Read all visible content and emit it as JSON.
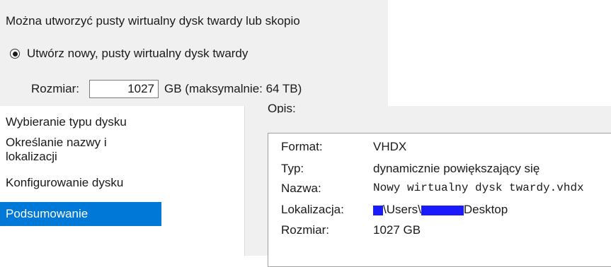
{
  "wizard": {
    "intro_text": "Można utworzyć pusty wirtualny dysk twardy lub skopio",
    "new_disk_option": "Utwórz nowy, pusty wirtualny dysk twardy",
    "size_label": "Rozmiar:",
    "size_value": "1027",
    "size_unit": "GB (maksymalnie: 64 TB)"
  },
  "sidebar": {
    "items": [
      {
        "label": "Wybieranie typu dysku"
      },
      {
        "label": "Określanie nazwy i lokalizacji"
      },
      {
        "label": "Konfigurowanie dysku"
      },
      {
        "label": "Podsumowanie"
      }
    ],
    "active_index": 3
  },
  "summary": {
    "heading": "Opis:",
    "rows": [
      {
        "key": "Format:",
        "value": "VHDX"
      },
      {
        "key": "Typ:",
        "value": "dynamicznie powiększający się"
      },
      {
        "key": "Nazwa:",
        "value": "Nowy wirtualny dysk twardy.vhdx"
      },
      {
        "key": "Lokalizacja:",
        "value_parts": [
          "\\Users\\",
          "Desktop"
        ]
      },
      {
        "key": "Rozmiar:",
        "value": "1027 GB"
      }
    ]
  },
  "colors": {
    "accent": "#0078d7",
    "redaction": "#1a1aff",
    "panel_bg": "#f0f0f0"
  }
}
